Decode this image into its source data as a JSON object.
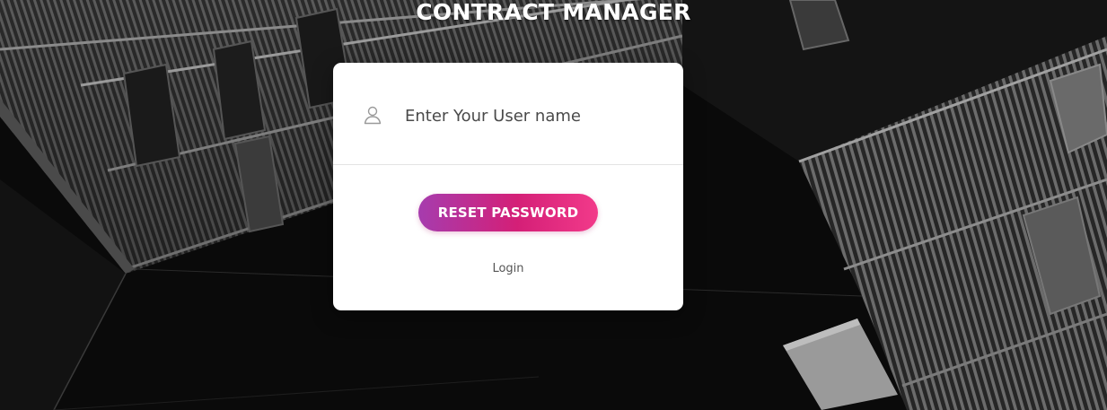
{
  "app": {
    "title": "CONTRACT MANAGER"
  },
  "form": {
    "username_placeholder": "Enter Your User name",
    "username_value": "",
    "user_icon": "user-icon",
    "reset_label": "RESET PASSWORD",
    "login_label": "Login"
  },
  "colors": {
    "background": "#0b0b0b",
    "card": "#ffffff",
    "button_gradient_start": "#a63cae",
    "button_gradient_mid": "#d41f77",
    "button_gradient_end": "#f23a8a"
  }
}
